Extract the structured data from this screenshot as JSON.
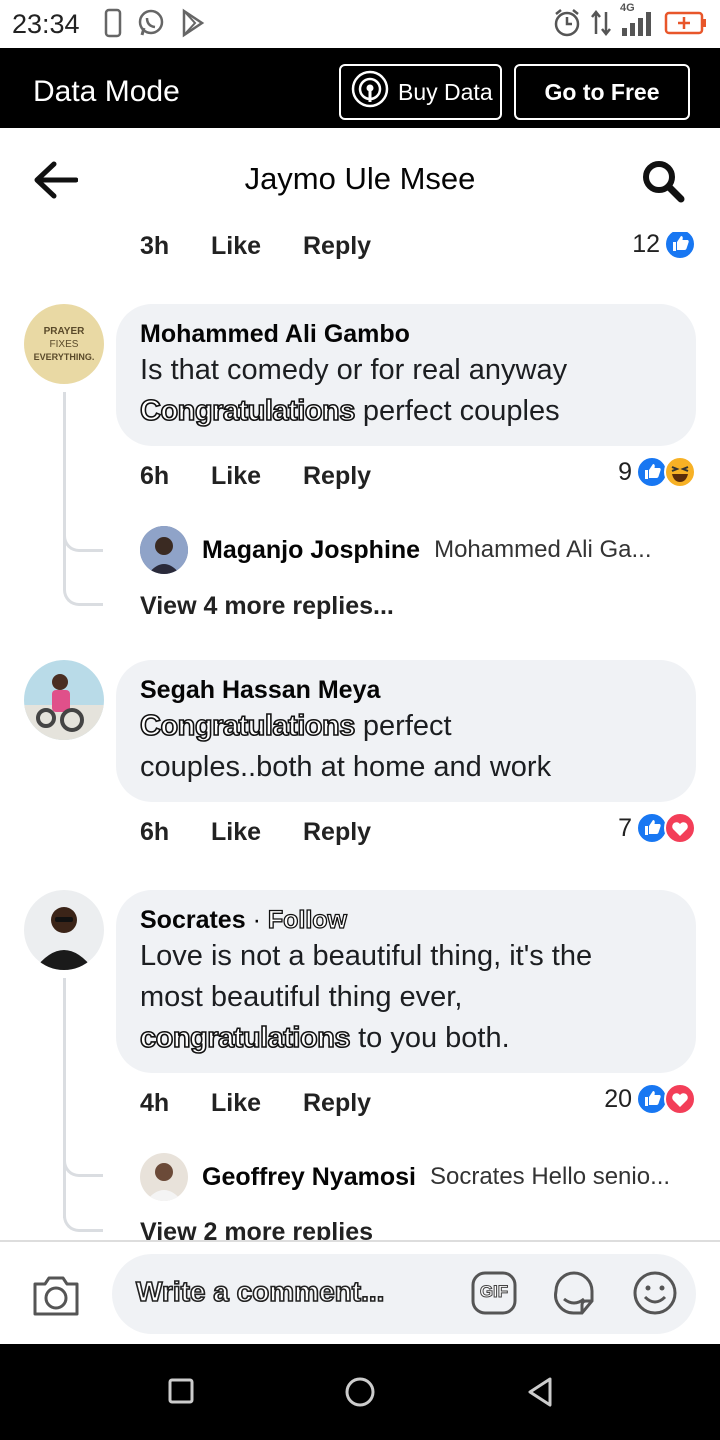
{
  "status_bar": {
    "time": "23:34",
    "left_icons": [
      "phone-outline-icon",
      "whatsapp-icon",
      "play-store-icon"
    ],
    "right_icons": [
      "alarm-icon",
      "data-arrows-icon",
      "signal-4g-icon",
      "battery-icon"
    ],
    "network_label": "4G"
  },
  "data_bar": {
    "mode_label": "Data Mode",
    "buy_data_label": "Buy Data",
    "go_free_label": "Go to Free"
  },
  "header": {
    "title": "Jaymo Ule Msee"
  },
  "top_meta": {
    "time": "3h",
    "like": "Like",
    "reply": "Reply",
    "count": "12"
  },
  "comments": [
    {
      "avatar_text": [
        "PRAYER",
        "FIXES",
        "EVERYTHING."
      ],
      "author": "Mohammed Ali Gambo",
      "line1": "Is that comedy or for real anyway",
      "highlight": "Congratulations",
      "line2_rest": " perfect couples",
      "time": "6h",
      "like": "Like",
      "reply": "Reply",
      "count": "9",
      "reply_preview": {
        "name": "Maganjo Josphine",
        "text": "Mohammed Ali Ga..."
      },
      "view_more": "View 4 more replies..."
    },
    {
      "author": "Segah Hassan Meya",
      "highlight": "Congratulations",
      "line1_rest": " perfect",
      "line2": "couples..both at home and work",
      "time": "6h",
      "like": "Like",
      "reply": "Reply",
      "count": "7"
    },
    {
      "author": "Socrates",
      "separator": " · ",
      "follow": "Follow",
      "line1": "Love is not a beautiful thing, it's the",
      "line2": "most beautiful thing ever,",
      "highlight": "congratulations",
      "line3_rest": " to you both.",
      "time": "4h",
      "like": "Like",
      "reply": "Reply",
      "count": "20",
      "reply_preview": {
        "name": "Geoffrey Nyamosi",
        "text": "Socrates Hello senio..."
      },
      "view_more": "View 2 more replies"
    }
  ],
  "composer": {
    "placeholder": "Write a comment...",
    "gif_label": "GIF"
  },
  "colors": {
    "like_blue": "#1877f2",
    "love_red": "#f33e58",
    "haha_yellow": "#f7b125",
    "bubble_bg": "#f0f2f5"
  }
}
